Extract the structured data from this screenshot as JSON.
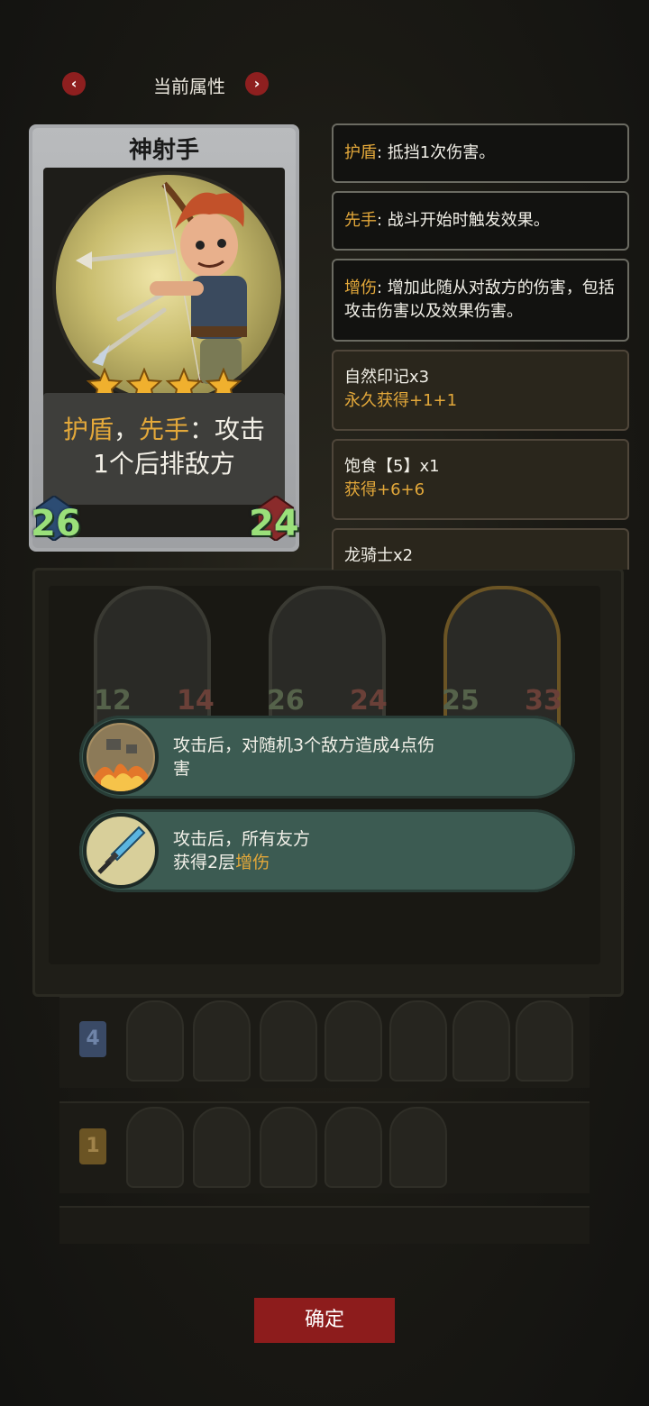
{
  "header": {
    "title": "当前属性",
    "prev_arrow": "‹",
    "next_arrow": "›"
  },
  "card": {
    "name": "神射手",
    "stars": 4,
    "desc_kw1": "护盾",
    "desc_sep1": "，",
    "desc_kw2": "先手",
    "desc_rest1": "：攻击",
    "desc_line2": "1个后排敌方",
    "attack": "26",
    "health": "24"
  },
  "info": [
    {
      "kw": "护盾",
      "text": ": 抵挡1次伤害。"
    },
    {
      "kw": "先手",
      "text": ": 战斗开始时触发效果。"
    },
    {
      "kw": "增伤",
      "text": ": 增加此随从对敌方的伤害，包括攻击伤害以及效果伤害。"
    },
    {
      "title": "自然印记x3",
      "sub": "永久获得+1+1"
    },
    {
      "title": "饱食【5】x1",
      "sub": "获得+6+6"
    },
    {
      "title": "龙骑士x2",
      "sub": ""
    }
  ],
  "board": {
    "slots": [
      {
        "attack": "12",
        "health": "14"
      },
      {
        "attack": "26",
        "health": "24"
      },
      {
        "attack": "25",
        "health": "33"
      }
    ],
    "bench_badges": [
      "4",
      "1"
    ]
  },
  "skills": [
    {
      "line1": "攻击后，对随机3个敌方造成4点伤",
      "line2": "害",
      "icon": "explosion-icon"
    },
    {
      "line1": "攻击后，所有友方",
      "line2_pre": "获得2层",
      "line2_kw": "增伤",
      "icon": "crystal-dagger-icon"
    }
  ],
  "confirm_label": "确定",
  "colors": {
    "keyword": "#e3a83a",
    "stat_green": "#9ae07a",
    "button_red": "#8d1c1c",
    "pill_teal": "#3c5b52"
  }
}
